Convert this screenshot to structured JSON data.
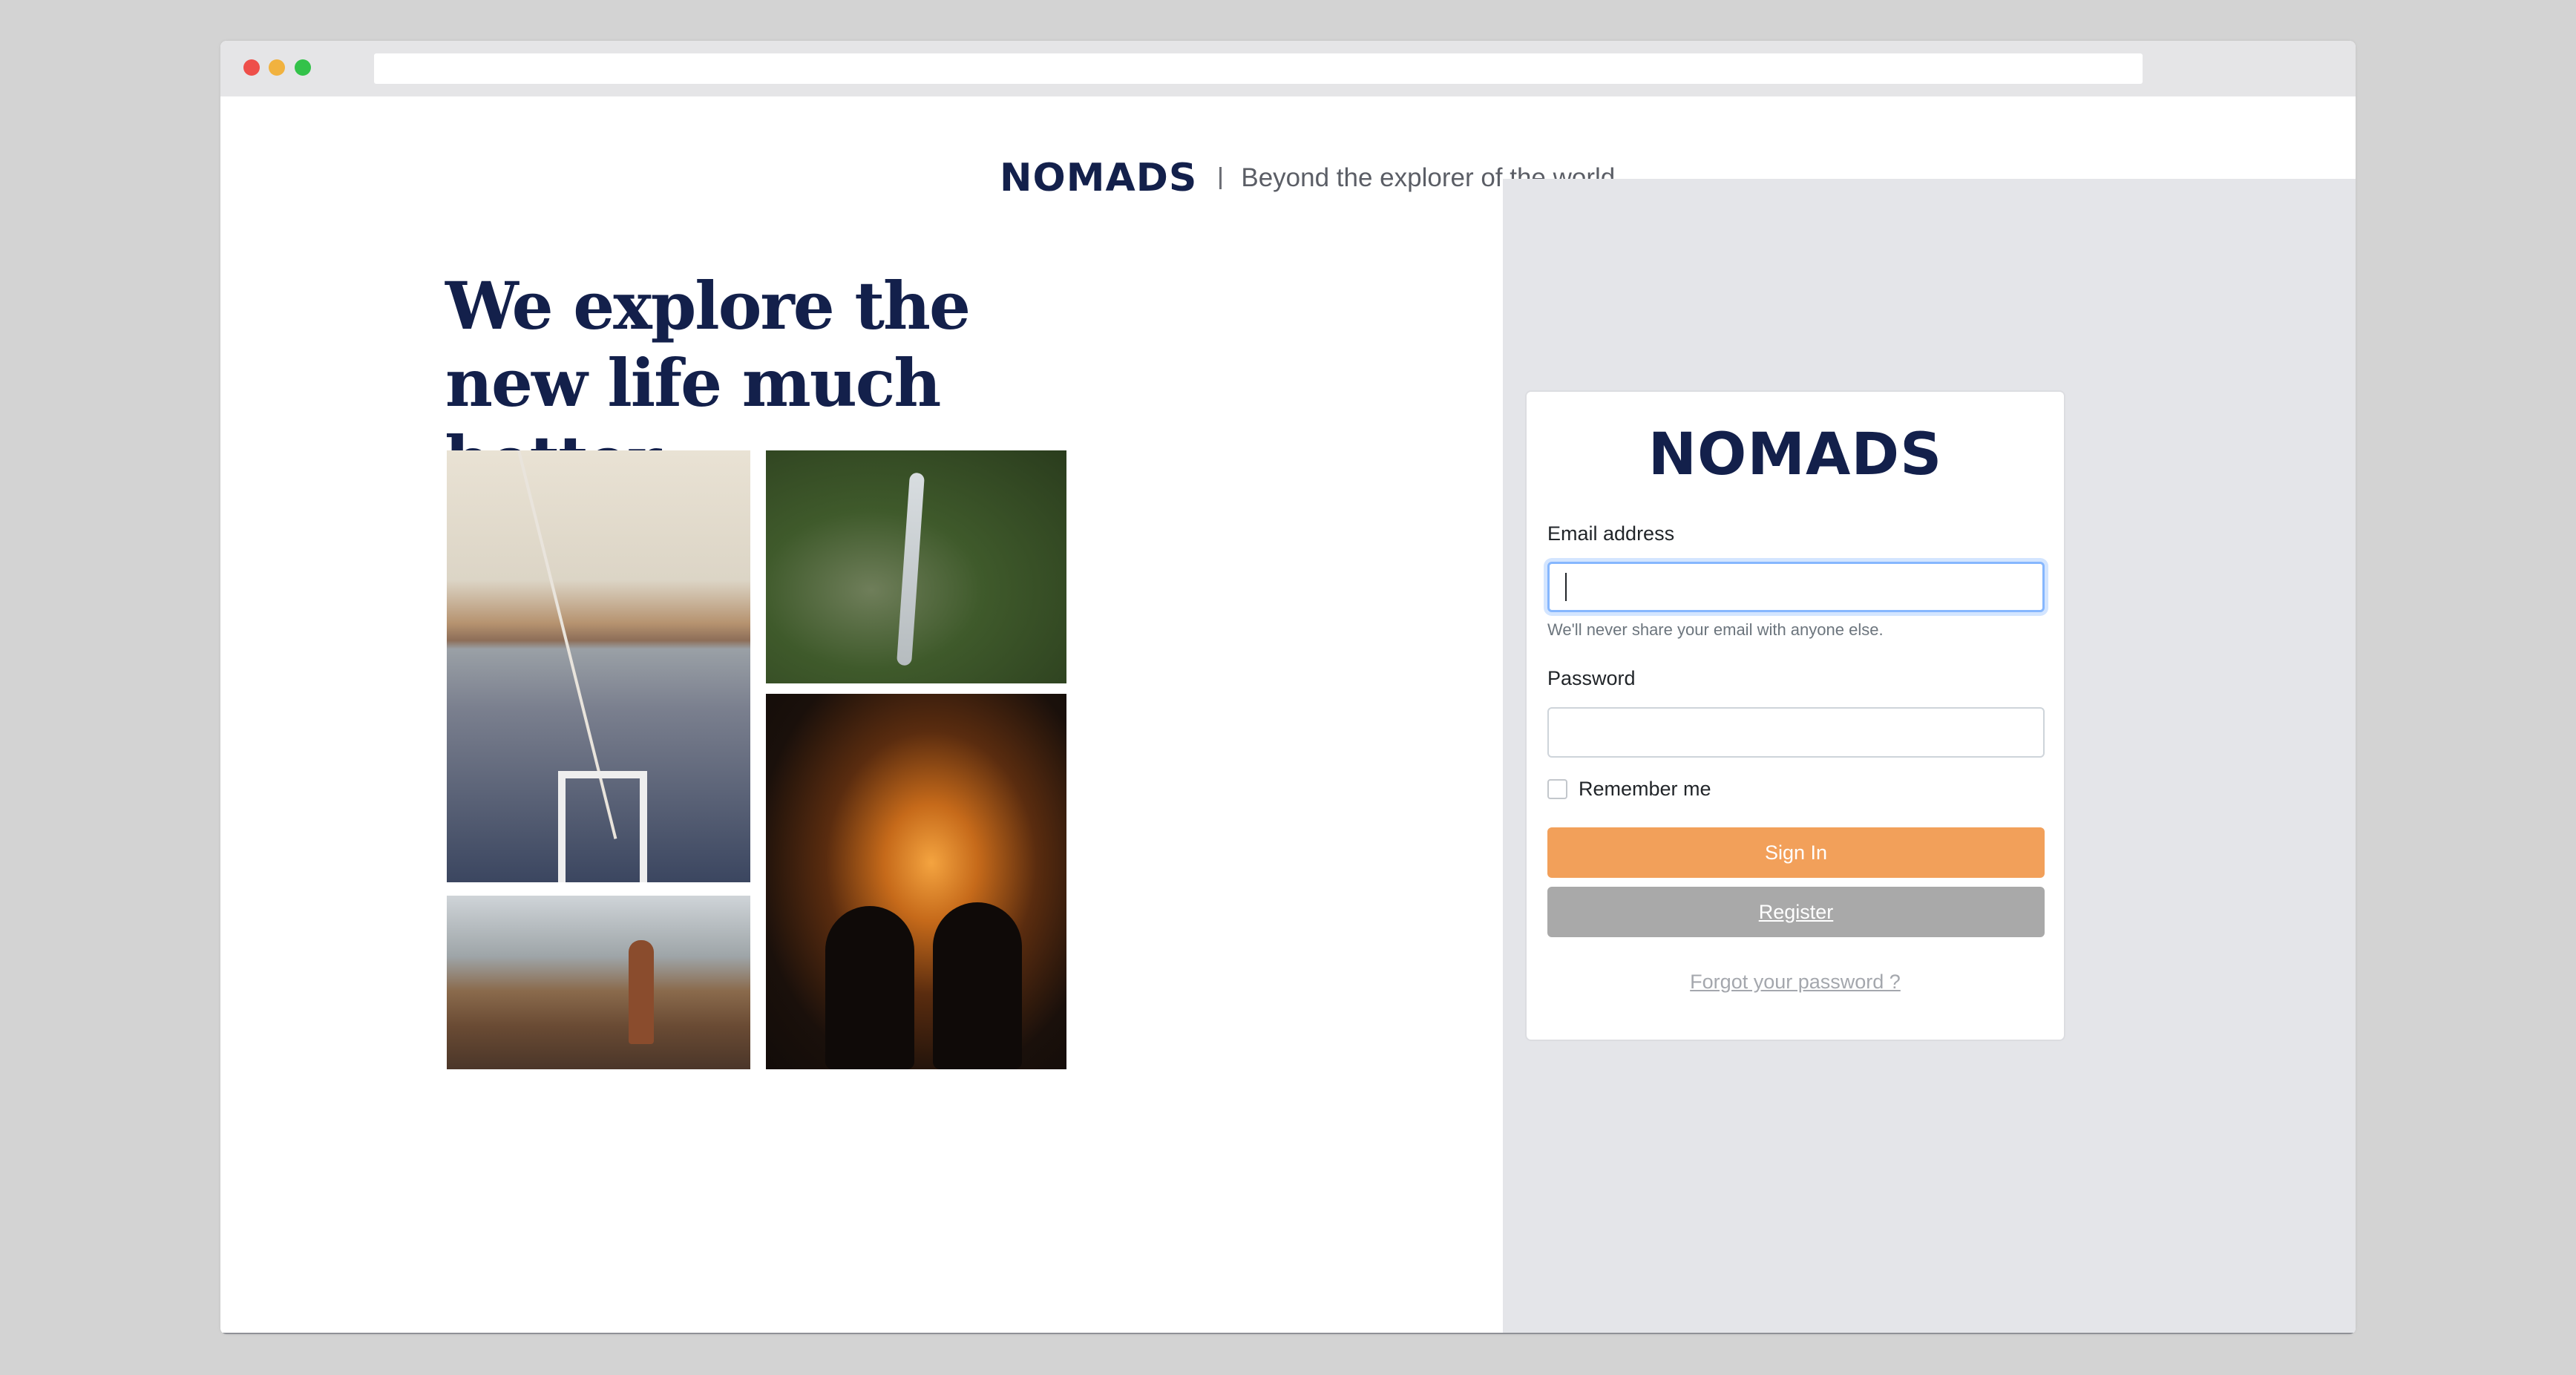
{
  "header": {
    "brand": "NOMADS",
    "tagline": "Beyond the explorer of the world"
  },
  "hero": {
    "headline": "We explore the new life much better"
  },
  "login": {
    "brand": "NOMADS",
    "email_label": "Email address",
    "email_value": "",
    "email_help": "We'll never share your email with anyone else.",
    "password_label": "Password",
    "password_value": "",
    "remember_label": "Remember me",
    "remember_checked": false,
    "signin_label": "Sign In",
    "register_label": "Register",
    "forgot_label": "Forgot your password ?"
  },
  "colors": {
    "brand_navy": "#13204b",
    "signin_orange": "#f2a05a",
    "register_gray": "#a9a9a9",
    "panel_gray": "#e4e5e9"
  }
}
